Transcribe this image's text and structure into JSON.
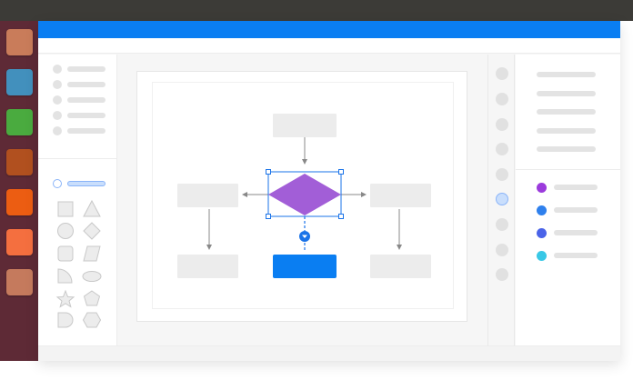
{
  "colors": {
    "os_topbar": "#3c3b37",
    "dock_background": "#5e2a36",
    "app_header": "#0a7ef2",
    "decision_fill": "#a25ed7",
    "selection_blue": "#1a73e8",
    "placeholder_gray": "#ececec"
  },
  "dock": {
    "apps": [
      {
        "name": "dock-app-1",
        "color": "#c97c5a"
      },
      {
        "name": "dock-app-2",
        "color": "#4290bd"
      },
      {
        "name": "dock-app-3",
        "color": "#4aab3f"
      },
      {
        "name": "dock-app-4",
        "color": "#b1501f"
      },
      {
        "name": "dock-app-5",
        "color": "#ec5d12"
      },
      {
        "name": "dock-app-6",
        "color": "#f46f3f"
      },
      {
        "name": "dock-app-7",
        "color": "#c57a5d"
      }
    ]
  },
  "shape_library": {
    "shapes": [
      "square-icon",
      "triangle-icon",
      "circle-icon",
      "diamond-icon",
      "rounded-rect-icon",
      "parallelogram-icon",
      "quarter-circle-icon",
      "ellipse-icon",
      "star-icon",
      "pentagon-icon",
      "delay-shape-icon",
      "hexagon-icon"
    ]
  },
  "canvas": {
    "diagram": {
      "selected_node": "decision-diamond",
      "connector_handle_icon": "chevron-down-icon"
    }
  },
  "style_panel": {
    "color_swatches": [
      "#9b3bdc",
      "#2f80ed",
      "#4a63e8",
      "#39c8e6"
    ]
  }
}
